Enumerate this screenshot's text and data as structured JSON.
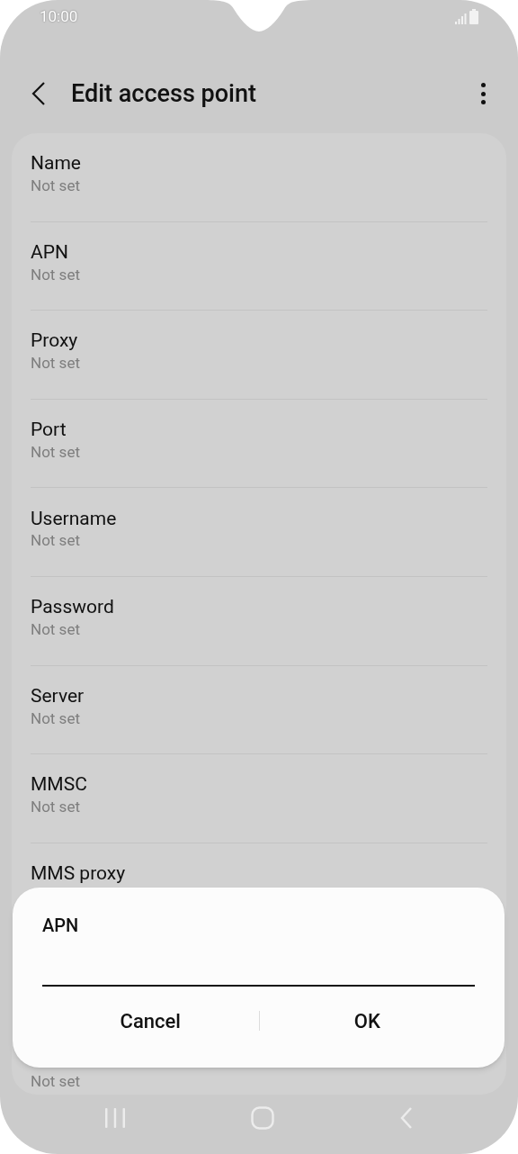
{
  "status_bar": {
    "time": "10:00"
  },
  "header": {
    "title": "Edit access point"
  },
  "settings": [
    {
      "label": "Name",
      "value": "Not set"
    },
    {
      "label": "APN",
      "value": "Not set"
    },
    {
      "label": "Proxy",
      "value": "Not set"
    },
    {
      "label": "Port",
      "value": "Not set"
    },
    {
      "label": "Username",
      "value": "Not set"
    },
    {
      "label": "Password",
      "value": "Not set"
    },
    {
      "label": "Server",
      "value": "Not set"
    },
    {
      "label": "MMSC",
      "value": "Not set"
    },
    {
      "label": "MMS proxy"
    },
    {
      "value": "Not set"
    }
  ],
  "dialog": {
    "title": "APN",
    "buttons": [
      "Cancel",
      "OK"
    ]
  }
}
